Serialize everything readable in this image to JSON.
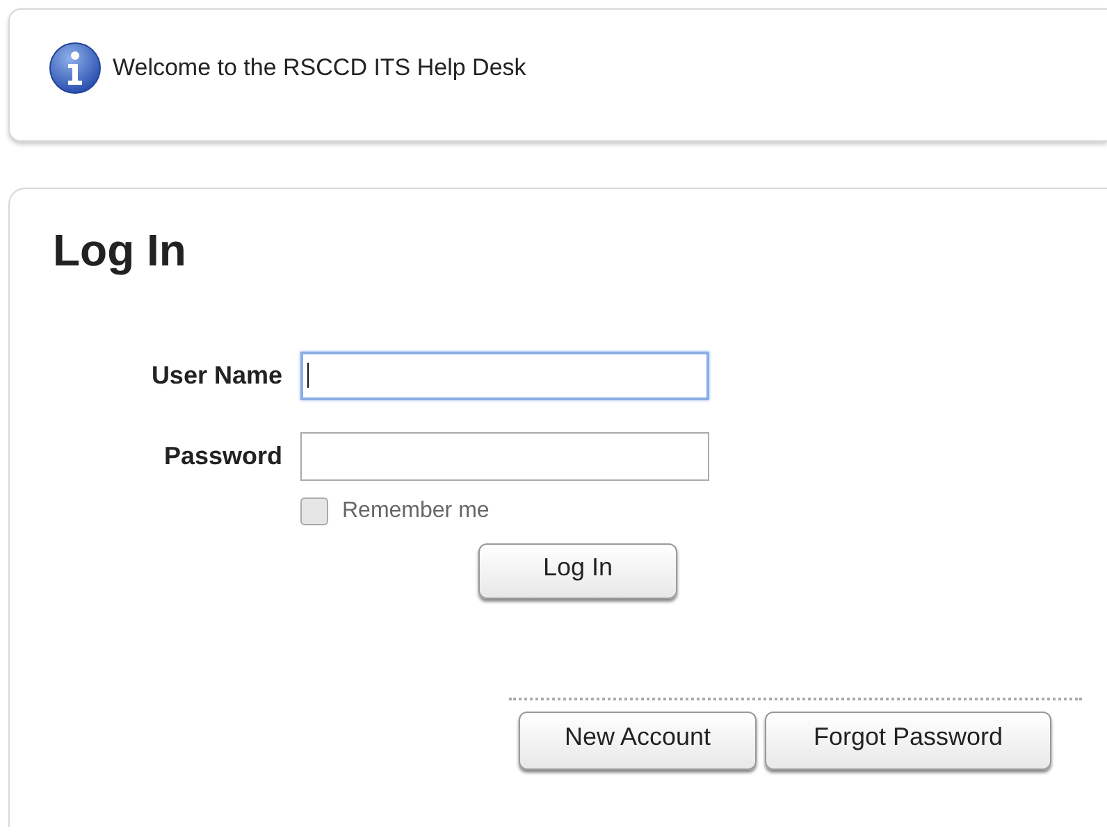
{
  "notice": {
    "message": "Welcome to the RSCCD ITS Help Desk"
  },
  "login": {
    "title": "Log In",
    "fields": [
      {
        "label": "User Name",
        "focused": true
      },
      {
        "label": "Password",
        "focused": false
      }
    ],
    "remember": {
      "label": "Remember me",
      "checked": false
    },
    "submit": "Log In",
    "links": [
      "New Account",
      "Forgot Password"
    ]
  }
}
